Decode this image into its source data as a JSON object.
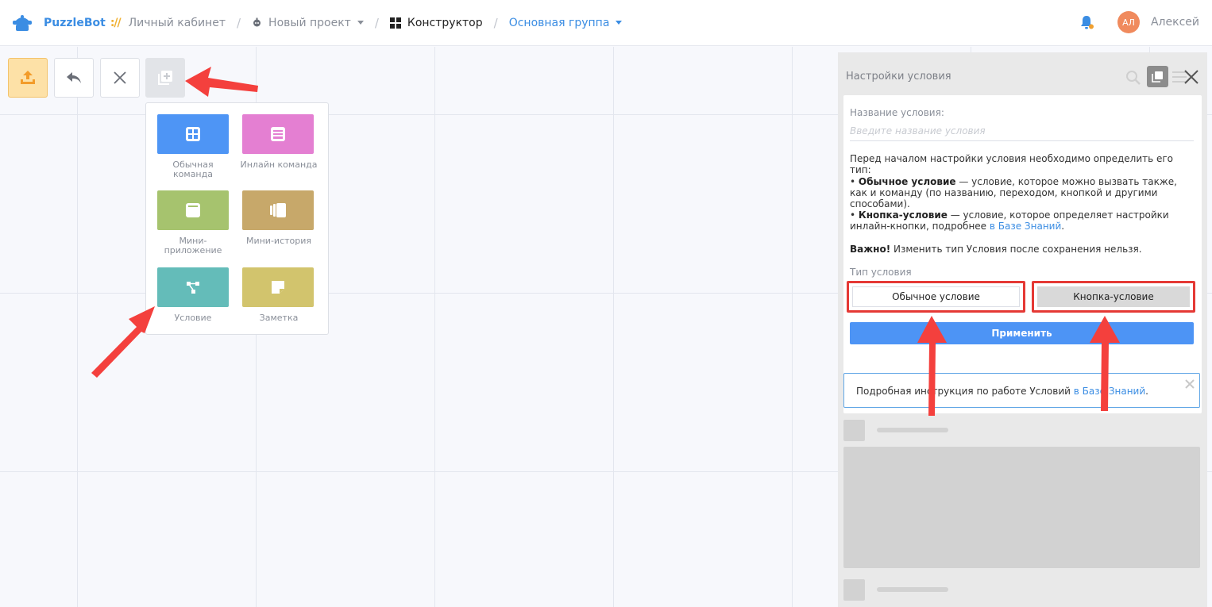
{
  "header": {
    "logo_text": "PuzzleBot",
    "logo_slash": "://",
    "breadcrumb": {
      "cabinet": "Личный кабинет",
      "project": "Новый проект",
      "constructor": "Конструктор",
      "group": "Основная группа"
    },
    "avatar_initials": "АЛ",
    "user_name": "Алексей"
  },
  "menu": {
    "items": [
      {
        "label": "Обычная команда",
        "color": "#4e95f5"
      },
      {
        "label": "Инлайн команда",
        "color": "#e47fd2"
      },
      {
        "label": "Мини-приложение",
        "color": "#a6c36e"
      },
      {
        "label": "Мини-история",
        "color": "#c7a86a"
      },
      {
        "label": "Условие",
        "color": "#64bcb9"
      },
      {
        "label": "Заметка",
        "color": "#d2c46d"
      }
    ]
  },
  "panel": {
    "title": "Настройки условия",
    "name_label": "Название условия:",
    "name_placeholder": "Введите название условия",
    "intro": "Перед началом настройки условия необходимо определить его тип:",
    "regular_bold": "Обычное условие",
    "regular_text": " — условие, которое можно вызвать также, как и команду (по названию, переходом, кнопкой и другими способами).",
    "button_bold": "Кнопка-условие",
    "button_text": " — условие, которое определяет настройки инлайн-кнопки, подробнее ",
    "button_link": "в Базе Знаний",
    "button_end": ".",
    "important_bold": "Важно!",
    "important_text": " Изменить тип Условия после сохранения нельзя.",
    "type_label": "Тип условия",
    "type_regular": "Обычное условие",
    "type_button": "Кнопка-условие",
    "apply": "Применить",
    "info_text": "Подробная инструкция по работе Условий ",
    "info_link": "в Базе Знаний",
    "info_end": "."
  },
  "colors": {
    "accent": "#3b8de3",
    "highlight": "#e53935",
    "apply": "#4d94f5"
  }
}
